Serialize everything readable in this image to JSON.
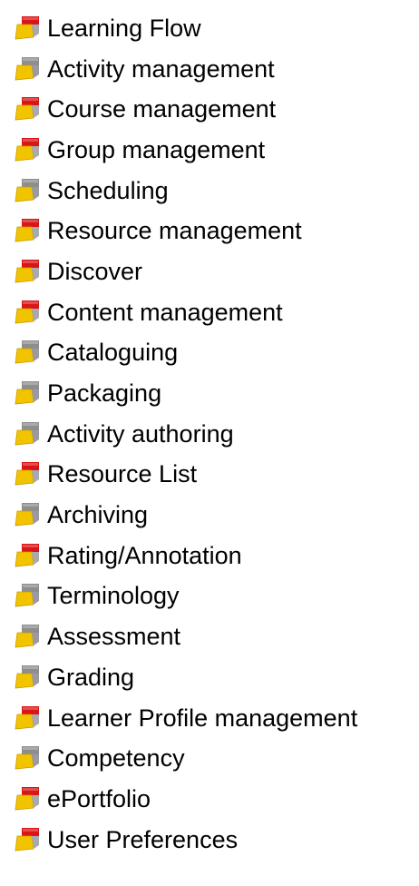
{
  "colors": {
    "icon_red": "#d91515",
    "icon_gray": "#8e8e8e",
    "icon_yellow": "#f2c400",
    "text": "#000000"
  },
  "items": [
    {
      "label": "Learning Flow",
      "icon": "module-icon",
      "highlight": "red"
    },
    {
      "label": "Activity management",
      "icon": "module-icon",
      "highlight": "gray"
    },
    {
      "label": "Course management",
      "icon": "module-icon",
      "highlight": "red"
    },
    {
      "label": "Group management",
      "icon": "module-icon",
      "highlight": "red"
    },
    {
      "label": "Scheduling",
      "icon": "module-icon",
      "highlight": "gray"
    },
    {
      "label": "Resource management",
      "icon": "module-icon",
      "highlight": "red"
    },
    {
      "label": "Discover",
      "icon": "module-icon",
      "highlight": "red"
    },
    {
      "label": "Content management",
      "icon": "module-icon",
      "highlight": "red"
    },
    {
      "label": "Cataloguing",
      "icon": "module-icon",
      "highlight": "gray"
    },
    {
      "label": "Packaging",
      "icon": "module-icon",
      "highlight": "gray"
    },
    {
      "label": "Activity authoring",
      "icon": "module-icon",
      "highlight": "gray"
    },
    {
      "label": "Resource List",
      "icon": "module-icon",
      "highlight": "red"
    },
    {
      "label": "Archiving",
      "icon": "module-icon",
      "highlight": "gray"
    },
    {
      "label": "Rating/Annotation",
      "icon": "module-icon",
      "highlight": "red"
    },
    {
      "label": "Terminology",
      "icon": "module-icon",
      "highlight": "gray"
    },
    {
      "label": "Assessment",
      "icon": "module-icon",
      "highlight": "gray"
    },
    {
      "label": "Grading",
      "icon": "module-icon",
      "highlight": "gray"
    },
    {
      "label": "Learner Profile management",
      "icon": "module-icon",
      "highlight": "red"
    },
    {
      "label": "Competency",
      "icon": "module-icon",
      "highlight": "gray"
    },
    {
      "label": "ePortfolio",
      "icon": "module-icon",
      "highlight": "red"
    },
    {
      "label": "User Preferences",
      "icon": "module-icon",
      "highlight": "red"
    }
  ]
}
